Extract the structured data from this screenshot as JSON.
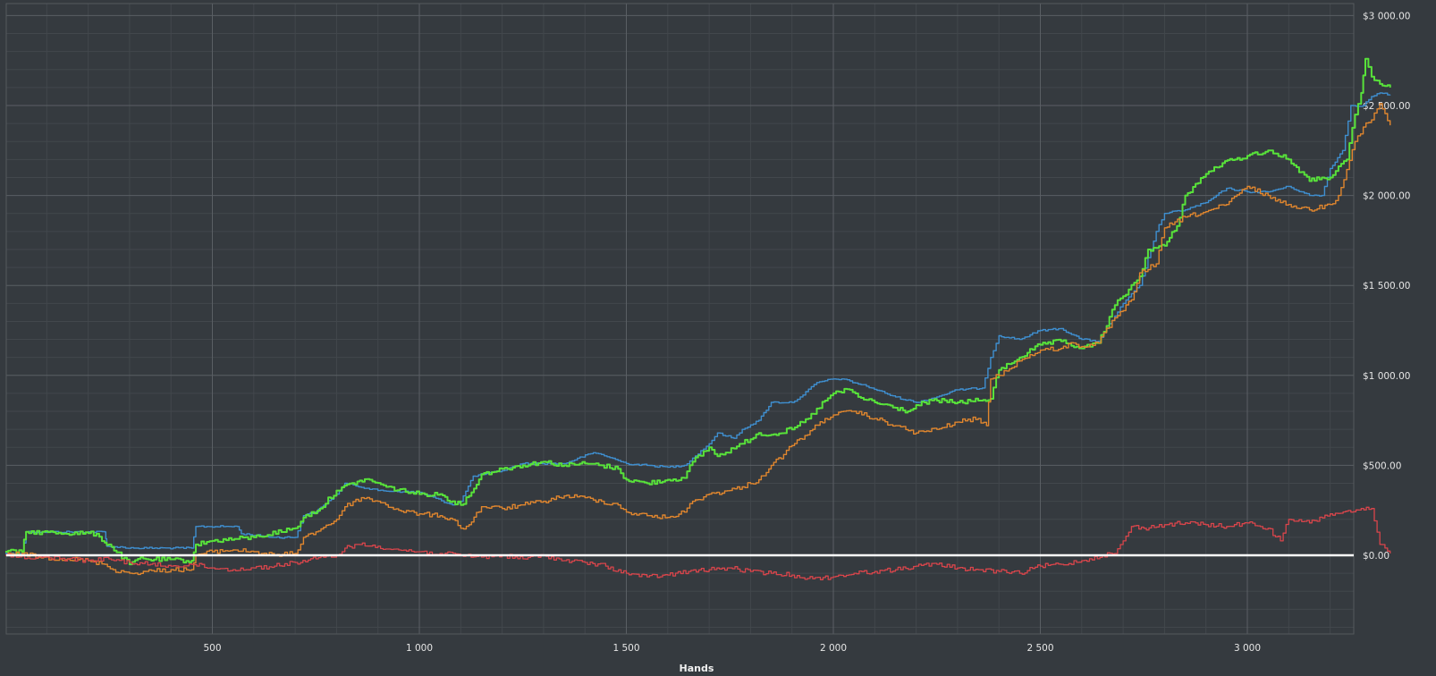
{
  "chart_data": {
    "type": "line",
    "title": "",
    "xlabel": "Hands",
    "ylabel": "",
    "xlim": [
      0,
      3350
    ],
    "ylim": [
      -440,
      3080
    ],
    "x_ticks": [
      {
        "value": 500,
        "label": "500"
      },
      {
        "value": 1000,
        "label": "1 000"
      },
      {
        "value": 1500,
        "label": "1 500"
      },
      {
        "value": 2000,
        "label": "2 000"
      },
      {
        "value": 2500,
        "label": "2 500"
      },
      {
        "value": 3000,
        "label": "3 000"
      }
    ],
    "y_ticks": [
      {
        "value": 3000,
        "label": "$3 000.00"
      },
      {
        "value": 2500,
        "label": "$2 500.00"
      },
      {
        "value": 2000,
        "label": "$2 000.00"
      },
      {
        "value": 1500,
        "label": "$1 500.00"
      },
      {
        "value": 1000,
        "label": "$1 000.00"
      },
      {
        "value": 500,
        "label": "$500.00"
      },
      {
        "value": 0,
        "label": "$0.00"
      }
    ],
    "grid": true,
    "legend": "none",
    "colors": {
      "background": "#353a3f",
      "grid_major": "#5a5f64",
      "grid_minor": "#42474c",
      "zero_line": "#ffffff",
      "blue": "#3f8fd0",
      "green": "#58e23a",
      "orange": "#e0862e",
      "red": "#d9454b"
    },
    "series": [
      {
        "color": "blue",
        "x": [
          0,
          40,
          50,
          240,
          245,
          310,
          450,
          460,
          560,
          570,
          650,
          700,
          720,
          730,
          750,
          800,
          820,
          900,
          1000,
          1080,
          1100,
          1130,
          1200,
          1250,
          1350,
          1420,
          1440,
          1500,
          1550,
          1600,
          1640,
          1700,
          1720,
          1760,
          1780,
          1820,
          1850,
          1900,
          1920,
          1960,
          2000,
          2020,
          2080,
          2150,
          2200,
          2250,
          2300,
          2360,
          2380,
          2400,
          2450,
          2500,
          2550,
          2600,
          2640,
          2700,
          2740,
          2780,
          2800,
          2850,
          2900,
          2950,
          3000,
          3050,
          3100,
          3150,
          3180,
          3200,
          3230,
          3250,
          3280,
          3300,
          3320,
          3345
        ],
        "values": [
          10,
          10,
          130,
          130,
          50,
          40,
          40,
          160,
          160,
          120,
          100,
          100,
          220,
          230,
          240,
          340,
          400,
          360,
          350,
          280,
          300,
          440,
          470,
          510,
          510,
          570,
          560,
          510,
          500,
          490,
          500,
          620,
          680,
          650,
          700,
          750,
          850,
          850,
          880,
          960,
          980,
          980,
          940,
          880,
          850,
          880,
          920,
          930,
          1100,
          1220,
          1200,
          1250,
          1260,
          1200,
          1190,
          1400,
          1500,
          1800,
          1900,
          1920,
          1960,
          2040,
          2020,
          2020,
          2050,
          2000,
          2000,
          2150,
          2250,
          2500,
          2500,
          2550,
          2570,
          2560
        ]
      },
      {
        "color": "green",
        "x": [
          0,
          40,
          50,
          220,
          240,
          250,
          300,
          320,
          450,
          460,
          500,
          600,
          700,
          720,
          760,
          800,
          850,
          880,
          920,
          1000,
          1050,
          1080,
          1100,
          1120,
          1150,
          1200,
          1250,
          1300,
          1350,
          1400,
          1440,
          1480,
          1500,
          1550,
          1600,
          1640,
          1660,
          1700,
          1720,
          1780,
          1820,
          1850,
          1900,
          1940,
          1980,
          2000,
          2040,
          2060,
          2100,
          2150,
          2180,
          2220,
          2250,
          2300,
          2350,
          2380,
          2400,
          2450,
          2500,
          2550,
          2600,
          2640,
          2680,
          2700,
          2740,
          2760,
          2800,
          2830,
          2850,
          2900,
          2940,
          2970,
          3000,
          3050,
          3100,
          3150,
          3180,
          3200,
          3240,
          3260,
          3275,
          3285,
          3300,
          3320,
          3345
        ],
        "values": [
          20,
          20,
          130,
          120,
          70,
          60,
          -50,
          -20,
          -30,
          60,
          80,
          100,
          150,
          210,
          260,
          360,
          410,
          420,
          380,
          340,
          340,
          300,
          280,
          330,
          450,
          480,
          500,
          520,
          500,
          510,
          500,
          480,
          420,
          400,
          420,
          430,
          520,
          600,
          550,
          620,
          680,
          670,
          700,
          760,
          860,
          900,
          920,
          880,
          850,
          820,
          800,
          850,
          860,
          850,
          860,
          870,
          1030,
          1100,
          1170,
          1190,
          1150,
          1180,
          1390,
          1440,
          1550,
          1700,
          1720,
          1830,
          2000,
          2120,
          2180,
          2200,
          2220,
          2250,
          2200,
          2080,
          2100,
          2100,
          2200,
          2450,
          2570,
          2760,
          2660,
          2620,
          2600
        ]
      },
      {
        "color": "orange",
        "x": [
          0,
          40,
          80,
          150,
          200,
          240,
          260,
          300,
          340,
          400,
          450,
          460,
          500,
          550,
          600,
          650,
          700,
          720,
          750,
          800,
          820,
          860,
          900,
          950,
          1000,
          1050,
          1080,
          1100,
          1120,
          1150,
          1200,
          1250,
          1300,
          1350,
          1400,
          1440,
          1480,
          1500,
          1550,
          1600,
          1640,
          1660,
          1700,
          1750,
          1780,
          1820,
          1850,
          1880,
          1900,
          1950,
          1980,
          2000,
          2050,
          2100,
          2150,
          2200,
          2250,
          2300,
          2350,
          2370,
          2380,
          2400,
          2450,
          2500,
          2550,
          2580,
          2600,
          2640,
          2680,
          2700,
          2720,
          2740,
          2780,
          2800,
          2850,
          2900,
          2950,
          3000,
          3050,
          3080,
          3100,
          3150,
          3200,
          3220,
          3260,
          3280,
          3300,
          3320,
          3345
        ],
        "values": [
          0,
          10,
          -10,
          -20,
          -30,
          -50,
          -80,
          -100,
          -90,
          -80,
          -80,
          0,
          20,
          30,
          20,
          0,
          10,
          100,
          130,
          200,
          270,
          320,
          300,
          250,
          230,
          220,
          200,
          150,
          170,
          270,
          260,
          280,
          300,
          330,
          320,
          300,
          280,
          240,
          220,
          210,
          240,
          300,
          340,
          360,
          380,
          420,
          500,
          560,
          610,
          700,
          760,
          780,
          800,
          760,
          720,
          680,
          700,
          740,
          760,
          720,
          980,
          1000,
          1080,
          1140,
          1150,
          1180,
          1160,
          1180,
          1320,
          1360,
          1420,
          1570,
          1620,
          1820,
          1880,
          1910,
          1950,
          2050,
          2000,
          1960,
          1950,
          1920,
          1950,
          2000,
          2300,
          2380,
          2420,
          2510,
          2390
        ]
      },
      {
        "color": "red",
        "x": [
          0,
          60,
          100,
          150,
          200,
          250,
          300,
          350,
          400,
          450,
          500,
          550,
          600,
          650,
          700,
          750,
          800,
          820,
          850,
          900,
          950,
          1000,
          1050,
          1100,
          1150,
          1200,
          1250,
          1300,
          1350,
          1400,
          1450,
          1500,
          1550,
          1600,
          1650,
          1700,
          1750,
          1800,
          1850,
          1900,
          1950,
          2000,
          2050,
          2100,
          2150,
          2200,
          2250,
          2300,
          2350,
          2400,
          2450,
          2500,
          2550,
          2600,
          2650,
          2680,
          2700,
          2720,
          2750,
          2800,
          2850,
          2900,
          2950,
          3000,
          3050,
          3080,
          3100,
          3150,
          3200,
          3250,
          3300,
          3320,
          3345
        ],
        "values": [
          0,
          -20,
          -10,
          -20,
          -30,
          -20,
          -40,
          -50,
          -60,
          -50,
          -70,
          -80,
          -70,
          -60,
          -40,
          -20,
          0,
          40,
          60,
          50,
          30,
          20,
          10,
          0,
          -10,
          0,
          -20,
          0,
          -30,
          -40,
          -60,
          -100,
          -120,
          -110,
          -90,
          -80,
          -70,
          -90,
          -100,
          -110,
          -130,
          -120,
          -100,
          -90,
          -80,
          -60,
          -50,
          -70,
          -80,
          -90,
          -100,
          -60,
          -50,
          -30,
          0,
          10,
          80,
          160,
          150,
          170,
          180,
          170,
          160,
          180,
          150,
          80,
          200,
          180,
          230,
          240,
          260,
          60,
          10
        ]
      }
    ]
  }
}
